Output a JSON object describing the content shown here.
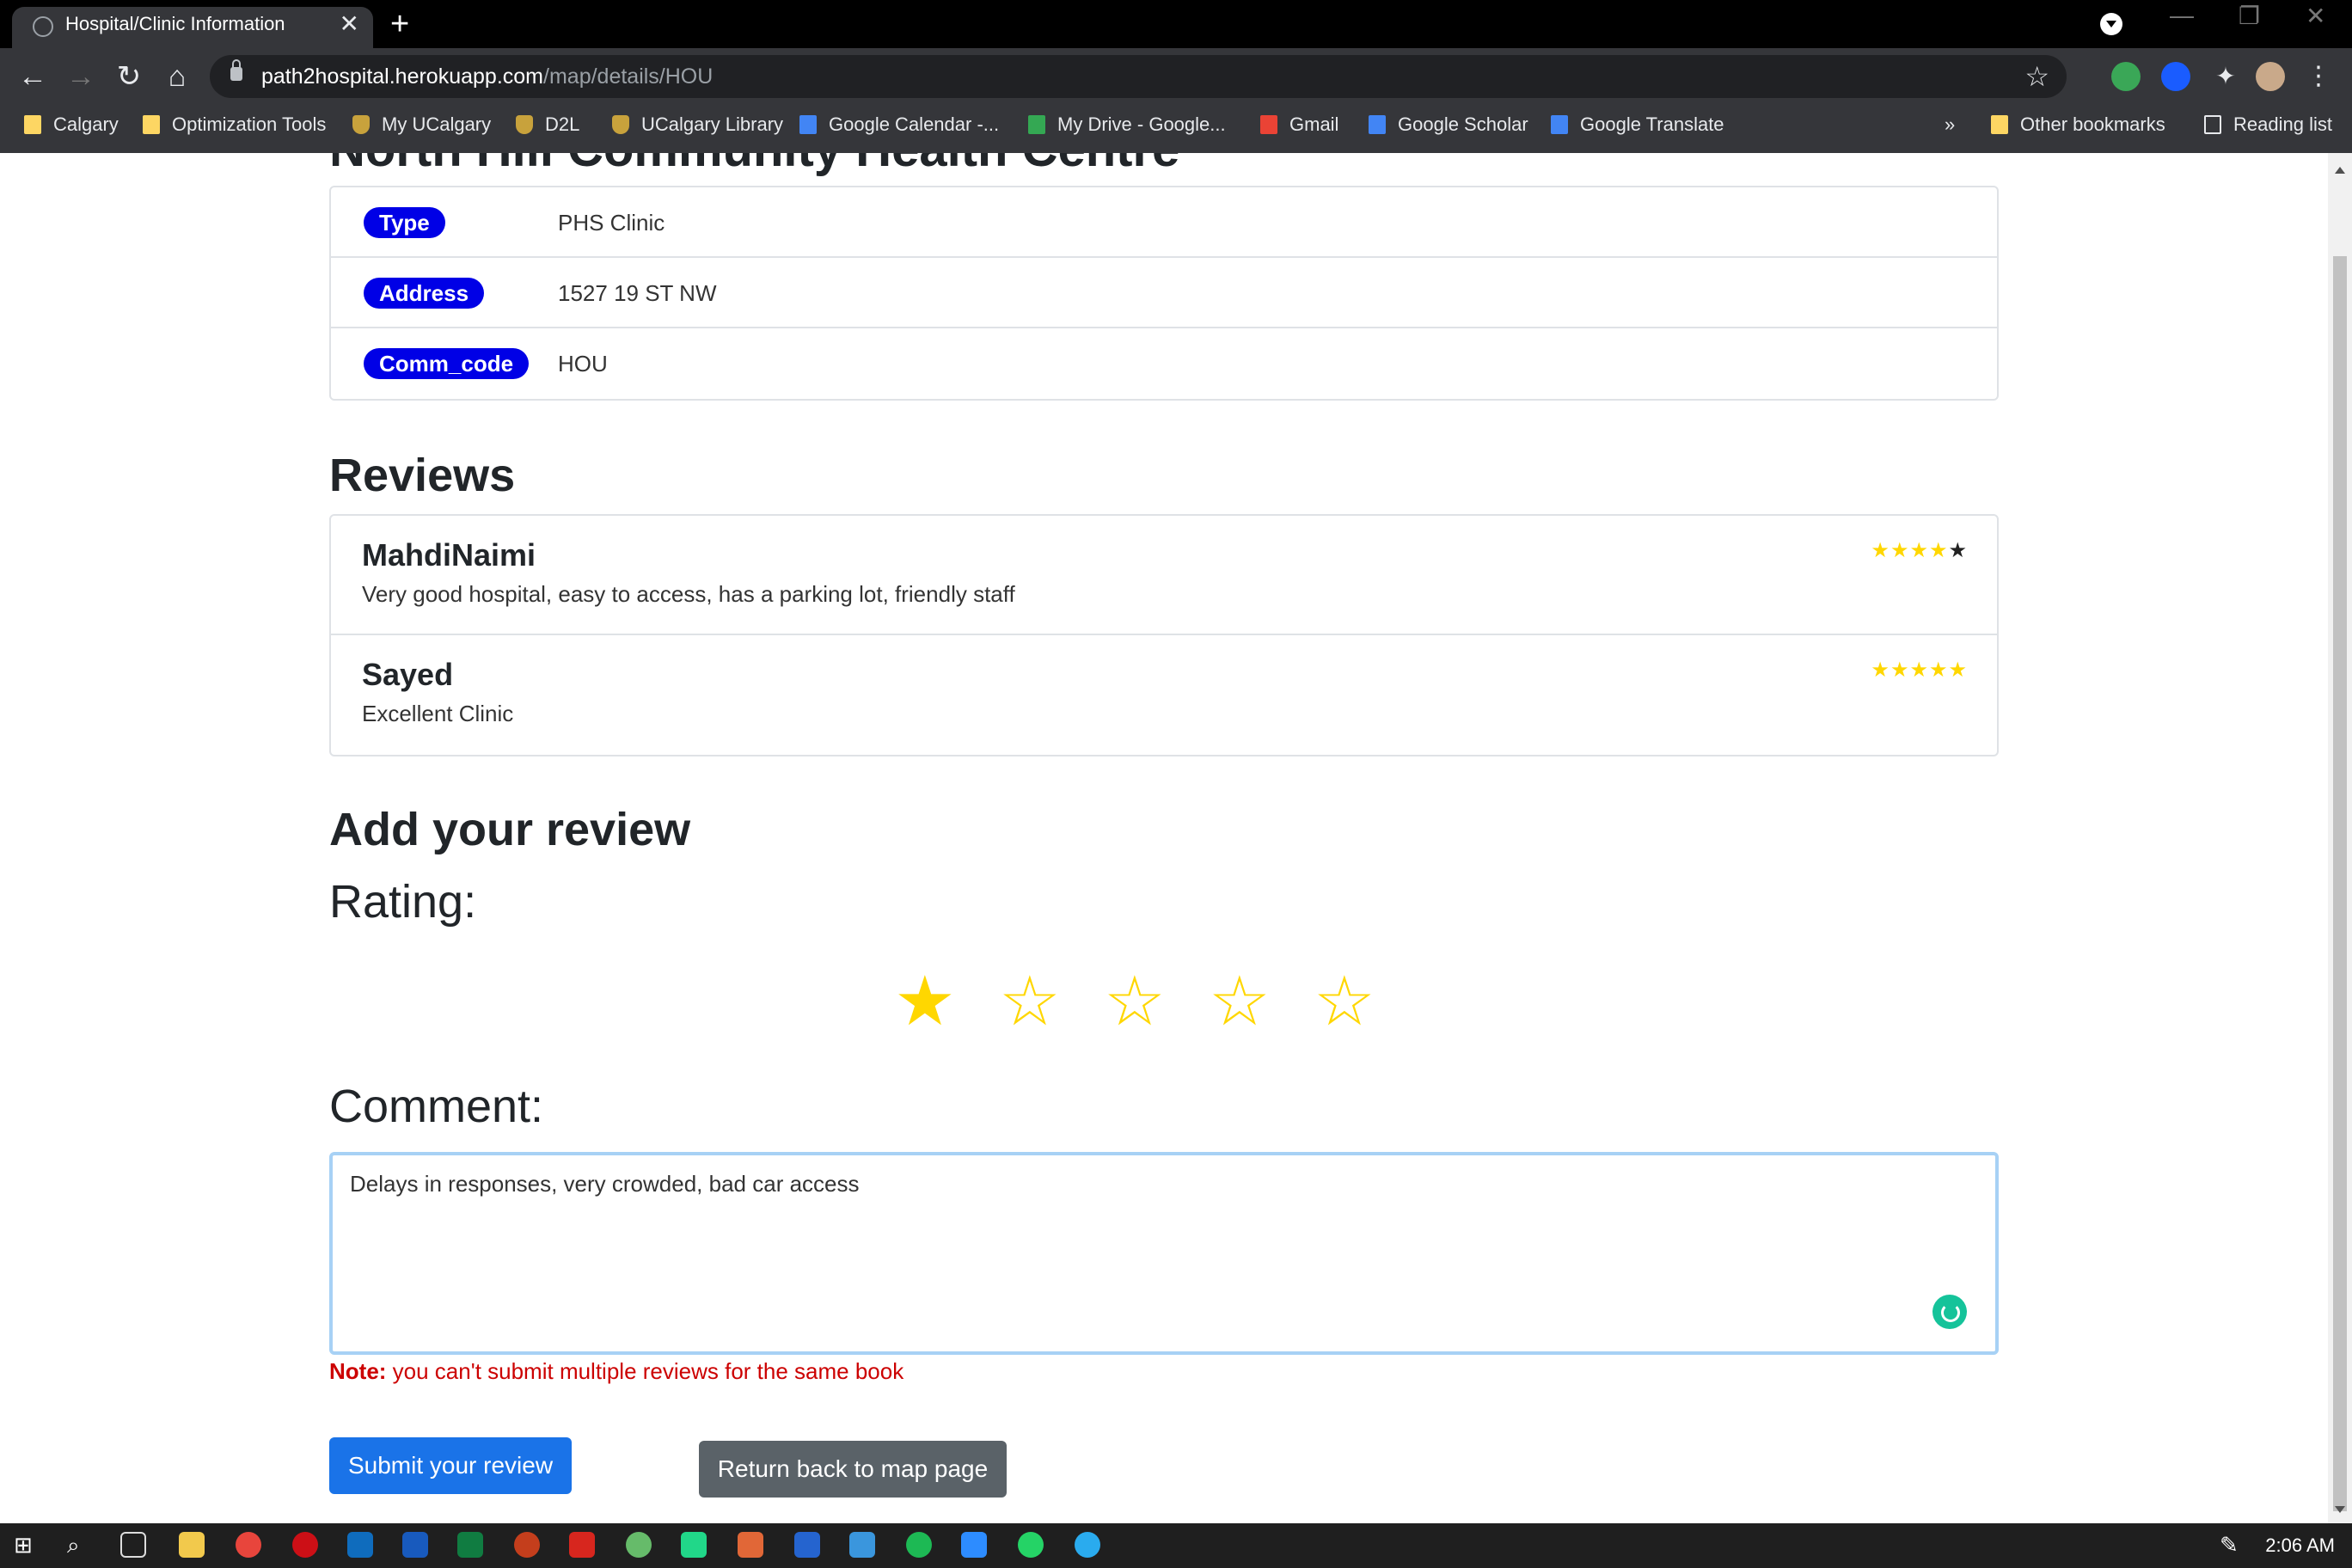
{
  "browser": {
    "tab_title": "Hospital/Clinic Information",
    "new_tab": "+",
    "close_tab": "✕",
    "url_host": "path2hospital.herokuapp.com",
    "url_path": "/map/details/HOU"
  },
  "bookmarks": [
    {
      "label": "Calgary",
      "icon": "folder-icon"
    },
    {
      "label": "Optimization Tools",
      "icon": "folder-icon"
    },
    {
      "label": "My UCalgary",
      "icon": "ucalgary-shield-icon"
    },
    {
      "label": "D2L",
      "icon": "ucalgary-shield-icon"
    },
    {
      "label": "UCalgary Library",
      "icon": "ucalgary-shield-icon"
    },
    {
      "label": "Google Calendar -...",
      "icon": "google-calendar-icon"
    },
    {
      "label": "My Drive - Google...",
      "icon": "google-drive-icon"
    },
    {
      "label": "Gmail",
      "icon": "gmail-icon"
    },
    {
      "label": "Google Scholar",
      "icon": "google-scholar-icon"
    },
    {
      "label": "Google Translate",
      "icon": "google-translate-icon"
    }
  ],
  "bookmarks_overflow": "»",
  "other_bookmarks": "Other bookmarks",
  "reading_list": "Reading list",
  "page": {
    "partial_title": "North Hill Community Health Centre",
    "info": [
      {
        "label": "Type",
        "value": "PHS Clinic"
      },
      {
        "label": "Address",
        "value": "1527 19 ST NW"
      },
      {
        "label": "Comm_code",
        "value": "HOU"
      }
    ],
    "reviews_heading": "Reviews",
    "reviews": [
      {
        "user": "MahdiNaimi",
        "text": "Very good hospital, easy to access, has a parking lot, friendly staff",
        "rating": 4
      },
      {
        "user": "Sayed",
        "text": "Excellent Clinic",
        "rating": 5
      }
    ],
    "add_review_heading": "Add your review",
    "rating_label": "Rating:",
    "selected_rating": 1,
    "comment_label": "Comment:",
    "comment_value": "Delays in responses, very crowded, bad car access",
    "note_bold": "Note:",
    "note_text": " you can't submit multiple reviews for the same book",
    "submit_label": "Submit your review",
    "return_label": "Return back to map page"
  },
  "taskbar": {
    "clock": "2:06 AM"
  },
  "colors": {
    "pill": "#0000e6",
    "star": "#ffd700",
    "submit": "#1a73e8",
    "return": "#5a6268",
    "note": "#cc0000"
  }
}
